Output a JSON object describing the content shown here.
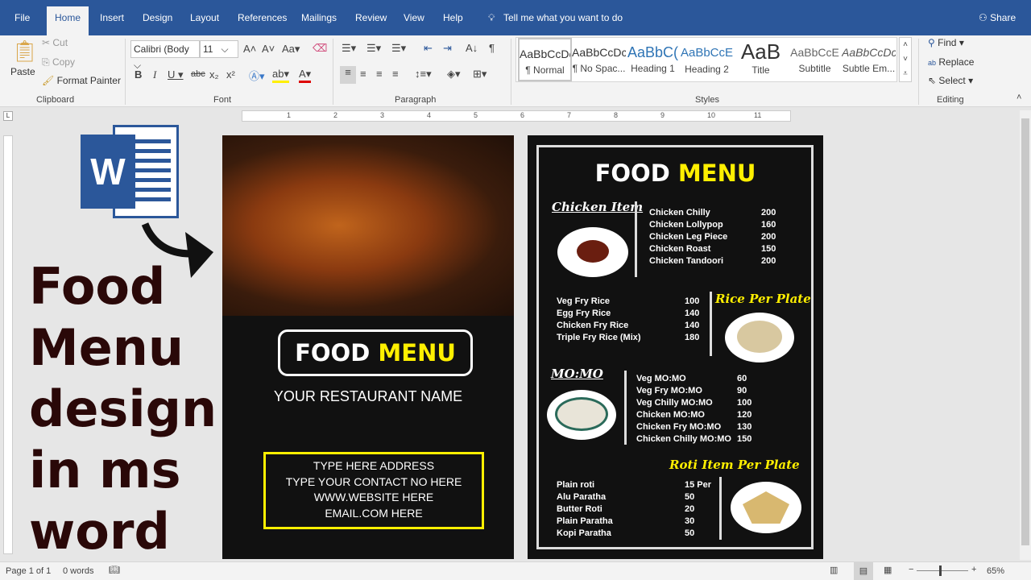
{
  "tabs": [
    "File",
    "Home",
    "Insert",
    "Design",
    "Layout",
    "References",
    "Mailings",
    "Review",
    "View",
    "Help"
  ],
  "tell_me": "Tell me what you want to do",
  "share": "Share",
  "clipboard": {
    "paste": "Paste",
    "cut": "Cut",
    "copy": "Copy",
    "format_painter": "Format Painter",
    "label": "Clipboard"
  },
  "font": {
    "name": "Calibri (Body",
    "size": "11",
    "label": "Font",
    "case": "Aa"
  },
  "paragraph": {
    "label": "Paragraph"
  },
  "styles": {
    "label": "Styles",
    "items": [
      {
        "preview": "AaBbCcDc",
        "name": "¶ Normal"
      },
      {
        "preview": "AaBbCcDc",
        "name": "¶ No Spac..."
      },
      {
        "preview": "AaBbC(",
        "name": "Heading 1"
      },
      {
        "preview": "AaBbCcE",
        "name": "Heading 2"
      },
      {
        "preview": "AaB",
        "name": "Title"
      },
      {
        "preview": "AaBbCcE",
        "name": "Subtitle"
      },
      {
        "preview": "AaBbCcDc",
        "name": "Subtle Em..."
      }
    ]
  },
  "editing": {
    "find": "Find",
    "replace": "Replace",
    "select": "Select",
    "label": "Editing"
  },
  "ruler": [
    "1",
    "2",
    "3",
    "4",
    "5",
    "6",
    "7",
    "8",
    "9",
    "10",
    "11"
  ],
  "overlay": {
    "lines": [
      "Food",
      "Menu",
      "design",
      "in ms",
      "word"
    ]
  },
  "left_page": {
    "title_white": "FOOD",
    "title_yellow": "MENU",
    "restaurant": "YOUR RESTAURANT NAME",
    "contact": [
      "TYPE HERE ADDRESS",
      "TYPE YOUR CONTACT NO HERE",
      "WWW.WEBSITE HERE",
      "EMAIL.COM HERE"
    ]
  },
  "right_page": {
    "title_white": "FOOD",
    "title_yellow": "MENU",
    "sections": [
      {
        "heading": "Chicken Item",
        "items": [
          [
            "Chicken Chilly",
            "200"
          ],
          [
            "Chicken Lollypop",
            "160"
          ],
          [
            "Chicken Leg Piece",
            "200"
          ],
          [
            "Chicken Roast",
            "150"
          ],
          [
            "Chicken Tandoori",
            "200"
          ]
        ]
      },
      {
        "heading": "Rice Per Plate",
        "items": [
          [
            "Veg Fry Rice",
            "100"
          ],
          [
            "Egg Fry Rice",
            "140"
          ],
          [
            "Chicken Fry Rice",
            "140"
          ],
          [
            "Triple Fry Rice (Mix)",
            "180"
          ]
        ]
      },
      {
        "heading": "MO:MO",
        "items": [
          [
            "Veg MO:MO",
            "60"
          ],
          [
            "Veg Fry MO:MO",
            "90"
          ],
          [
            "Veg Chilly MO:MO",
            "100"
          ],
          [
            "Chicken MO:MO",
            "120"
          ],
          [
            "Chicken Fry MO:MO",
            "130"
          ],
          [
            "Chicken Chilly MO:MO",
            "150"
          ]
        ]
      },
      {
        "heading": "Roti Item  Per Plate",
        "items": [
          [
            "Plain roti",
            "15 Per"
          ],
          [
            "Alu Paratha",
            "50"
          ],
          [
            "Butter Roti",
            "20"
          ],
          [
            "Plain Paratha",
            "30"
          ],
          [
            "Kopi Paratha",
            "50"
          ]
        ]
      }
    ]
  },
  "status": {
    "page": "Page 1 of 1",
    "words": "0 words",
    "zoom": "65%"
  },
  "colors": {
    "word_blue": "#2b579a",
    "menu_yellow": "#ffef00",
    "title_text": "#2a0808"
  }
}
